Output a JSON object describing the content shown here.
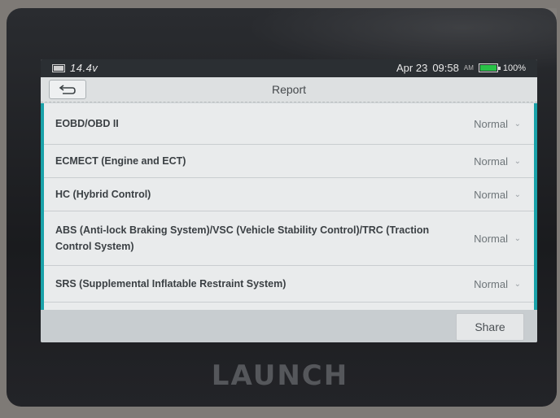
{
  "status_bar": {
    "voltage": "14.4v",
    "date": "Apr 23",
    "time": "09:58",
    "ampm": "AM",
    "battery_pct": "100%",
    "battery_color": "#29c247"
  },
  "header": {
    "back_icon": "back-arrow-icon",
    "title": "Report"
  },
  "systems": [
    {
      "label": "EOBD/OBD II",
      "status": "Normal"
    },
    {
      "label": "ECMECT (Engine and ECT)",
      "status": "Normal"
    },
    {
      "label": "HC (Hybrid Control)",
      "status": "Normal"
    },
    {
      "label": "ABS (Anti-lock Braking System)/VSC (Vehicle Stability Control)/TRC (Traction Control System)",
      "status": "Normal"
    },
    {
      "label": "SRS (Supplemental Inflatable Restraint System)",
      "status": "Normal"
    }
  ],
  "footer": {
    "share_label": "Share"
  },
  "device_brand": "LAUNCH",
  "accent_color": "#1aa2a9"
}
